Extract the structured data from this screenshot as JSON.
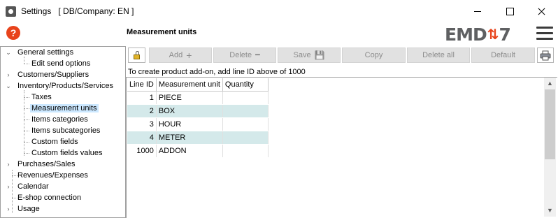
{
  "window": {
    "title": "Settings   [ DB/Company: EN ]"
  },
  "header": {
    "section_title": "Measurement units",
    "logo_left": "EMD",
    "logo_arrows": "⇅",
    "logo_num": "7"
  },
  "sidebar": {
    "items": [
      {
        "label": "General settings",
        "expander": "⌄"
      },
      {
        "label": "Edit send options"
      },
      {
        "label": "Customers/Suppliers",
        "expander": "›"
      },
      {
        "label": "Inventory/Products/Services",
        "expander": "⌄"
      },
      {
        "label": "Taxes"
      },
      {
        "label": "Measurement units"
      },
      {
        "label": "Items categories"
      },
      {
        "label": "Items subcategories"
      },
      {
        "label": "Custom fields"
      },
      {
        "label": "Custom fields values"
      },
      {
        "label": "Purchases/Sales",
        "expander": "›"
      },
      {
        "label": "Revenues/Expenses"
      },
      {
        "label": "Calendar",
        "expander": "›"
      },
      {
        "label": "E-shop connection"
      },
      {
        "label": "Usage",
        "expander": "›"
      }
    ]
  },
  "toolbar": {
    "add_label": "Add",
    "add_glyph": "+",
    "delete_label": "Delete",
    "delete_glyph": "━",
    "save_label": "Save",
    "save_glyph": "💾",
    "copy_label": "Copy",
    "delete_all_label": "Delete all",
    "default_label": "Default"
  },
  "info": {
    "text": "To create product add-on, add line ID above of 1000"
  },
  "grid": {
    "columns": [
      "Line ID",
      "Measurement unit",
      "Quantity"
    ],
    "rows": [
      {
        "id": "1",
        "unit": "PIECE",
        "qty": ""
      },
      {
        "id": "2",
        "unit": "BOX",
        "qty": ""
      },
      {
        "id": "3",
        "unit": "HOUR",
        "qty": ""
      },
      {
        "id": "4",
        "unit": "METER",
        "qty": ""
      },
      {
        "id": "1000",
        "unit": "ADDON",
        "qty": ""
      }
    ]
  },
  "scroll": {
    "up": "▲",
    "down": "▼"
  },
  "colors": {
    "accent": "#e8431b",
    "row_alt": "#d4e9ea",
    "selection": "#cce8ff"
  }
}
